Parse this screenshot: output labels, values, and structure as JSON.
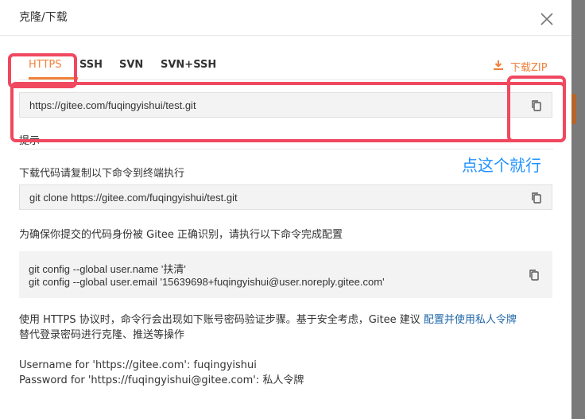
{
  "dialog": {
    "title": "克隆/下载"
  },
  "tabs": [
    {
      "label": "HTTPS",
      "active": true
    },
    {
      "label": "SSH",
      "active": false
    },
    {
      "label": "SVN",
      "active": false
    },
    {
      "label": "SVN+SSH",
      "active": false
    }
  ],
  "download_zip_label": "下载ZIP",
  "repo_url": "https://gitee.com/fuqingyishui/test.git",
  "hint_title": "提示",
  "download_instruction": "下载代码请复制以下命令到终端执行",
  "clone_command": "git clone https://gitee.com/fuqingyishui/test.git",
  "config_instruction": "为确保你提交的代码身份被 Gitee 正确识别，请执行以下命令完成配置",
  "config_commands": [
    "git config --global user.name '扶清'",
    "git config --global user.email '15639698+fuqingyishui@user.noreply.gitee.com'"
  ],
  "https_notice": {
    "before_link": "使用 HTTPS 协议时，命令行会出现如下账号密码验证步骤。基于安全考虑，Gitee 建议 ",
    "link": "配置并使用私人令牌",
    "after_link": "替代登录密码进行克隆、推送等操作"
  },
  "credentials_example": [
    "Username for 'https://gitee.com': fuqingyishui",
    "Password for 'https://fuqingyishui@gitee.com': 私人令牌"
  ],
  "annotation": {
    "text": "点这个就行",
    "color": "#1e90ff",
    "box_color": "#f0485f"
  },
  "colors": {
    "accent": "#f0813a",
    "link": "#2067a8"
  }
}
